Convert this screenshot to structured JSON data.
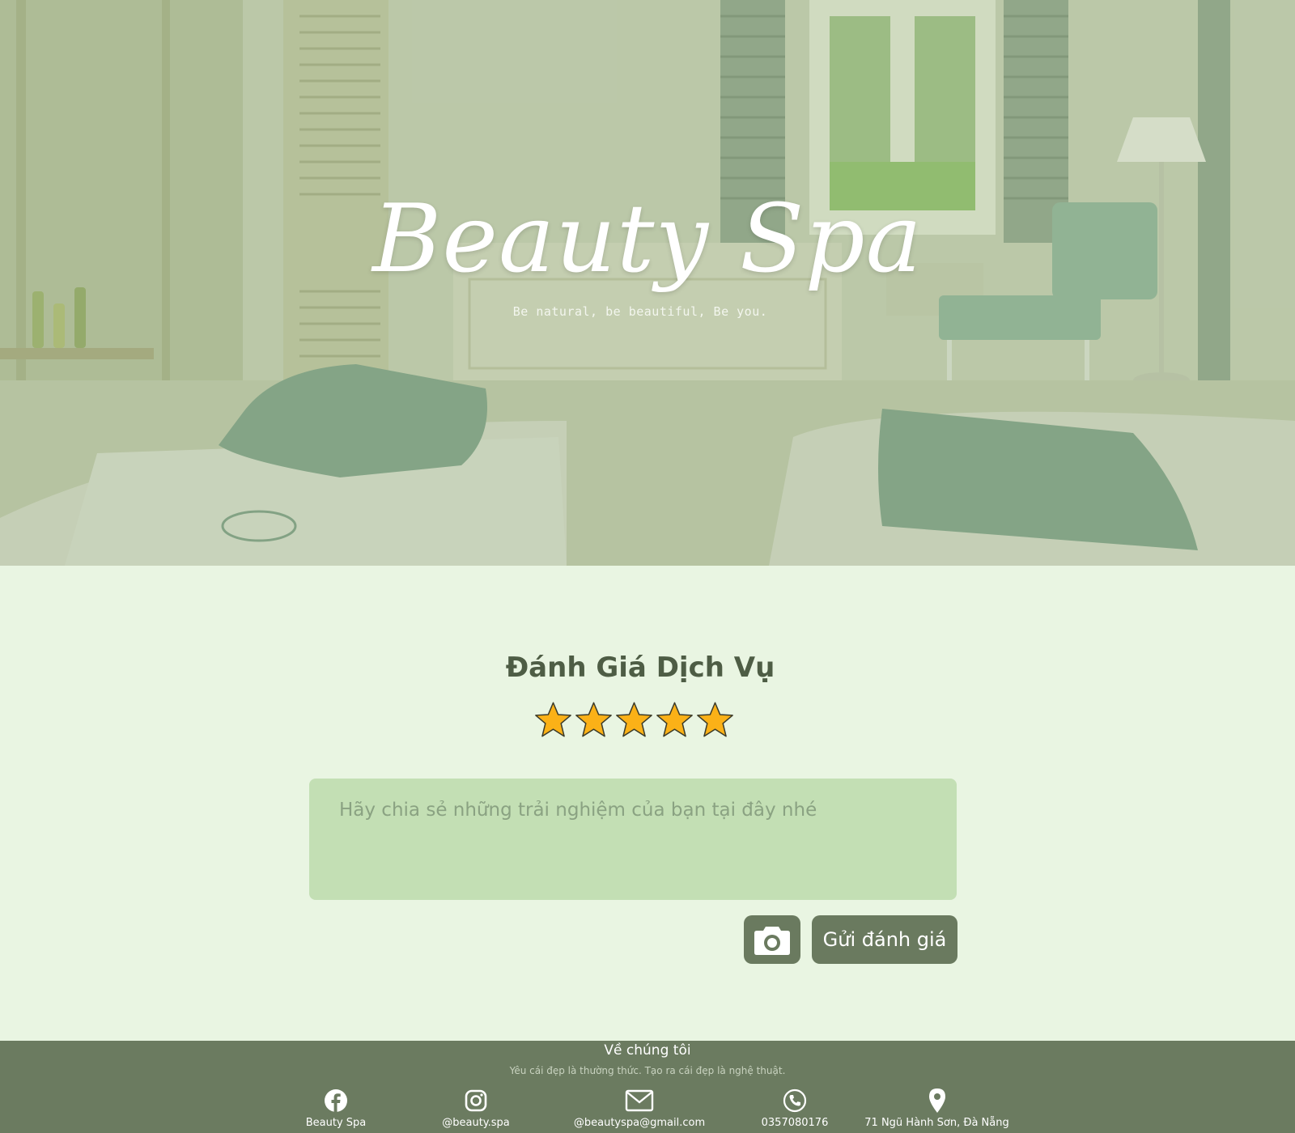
{
  "hero": {
    "title": "Beauty Spa",
    "tagline": "Be natural, be beautiful, Be you."
  },
  "review": {
    "title": "Đánh Giá Dịch Vụ",
    "rating": 5,
    "max_rating": 5,
    "star_color": "#fbb117",
    "placeholder": "Hãy chia sẻ những trải nghiệm của bạn tại đây nhé",
    "camera_icon": "camera-icon",
    "submit_label": "Gửi đánh giá"
  },
  "footer": {
    "title": "Về chúng tôi",
    "subtitle": "Yêu cái đẹp là thường thức. Tạo ra cái đẹp là nghệ thuật.",
    "contacts": [
      {
        "icon": "facebook-icon",
        "label": "Beauty Spa"
      },
      {
        "icon": "instagram-icon",
        "label": "@beauty.spa"
      },
      {
        "icon": "mail-icon",
        "label": "@beautyspa@gmail.com"
      },
      {
        "icon": "phone-icon",
        "label": "0357080176"
      },
      {
        "icon": "location-pin-icon",
        "label": "71 Ngũ Hành Sơn, Đà Nẵng"
      }
    ]
  },
  "colors": {
    "page_background": "#e9f5e2",
    "accent": "#6a7a5f",
    "heading": "#4e5d45",
    "textarea": "#c3dfb4"
  }
}
